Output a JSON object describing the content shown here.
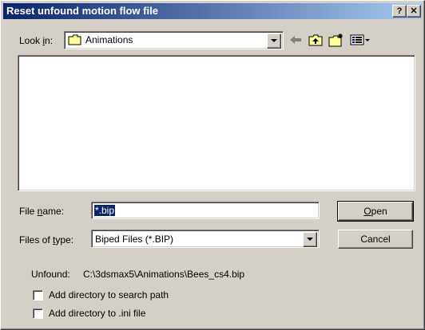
{
  "window": {
    "title": "Reset unfound motion flow file",
    "help_button": "?",
    "close_button": "✕"
  },
  "look_in": {
    "label_pre": "Look ",
    "label_key": "i",
    "label_post": "n:",
    "value": "Animations",
    "icons": [
      "folder-icon",
      "back-arrow-icon",
      "up-folder-icon",
      "new-folder-icon",
      "view-menu-icon"
    ]
  },
  "file_name": {
    "label_pre": "File ",
    "label_key": "n",
    "label_post": "ame:",
    "value": "*.bip"
  },
  "files_of_type": {
    "label_pre": "Files of ",
    "label_key": "t",
    "label_post": "ype:",
    "value": "Biped Files (*.BIP)"
  },
  "buttons": {
    "open_key": "O",
    "open_rest": "pen",
    "cancel": "Cancel"
  },
  "unfound": {
    "label": "Unfound:",
    "path": "C:\\3dsmax5\\Animations\\Bees_cs4.bip"
  },
  "checkboxes": [
    {
      "label": "Add directory to search path",
      "checked": false
    },
    {
      "label": "Add directory to .ini file",
      "checked": false
    }
  ]
}
